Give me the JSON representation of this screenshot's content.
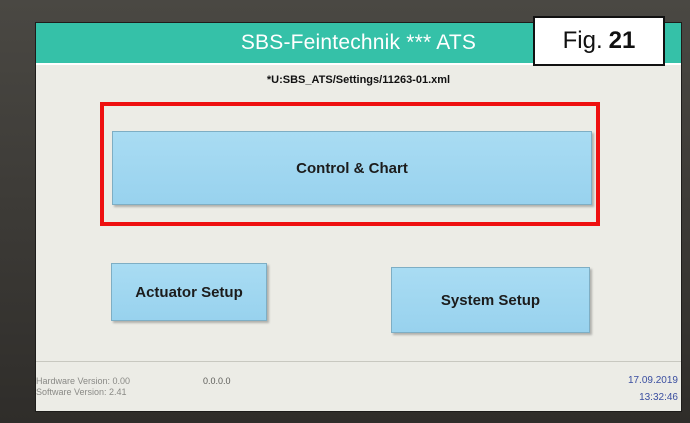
{
  "title": "SBS-Feintechnik  ***  ATS",
  "settings_path": "*U:SBS_ATS/Settings/11263-01.xml",
  "buttons": {
    "control_chart": "Control & Chart",
    "actuator_setup": "Actuator Setup",
    "system_setup": "System Setup"
  },
  "footer": {
    "hardware_version": "Hardware Version: 0.00",
    "software_version": "Software Version: 2.41",
    "version_code": "0.0.0.0",
    "date": "17.09.2019",
    "time": "13:32:46"
  },
  "figure_label": {
    "prefix": "Fig.",
    "number": "21"
  },
  "colors": {
    "title_bar": "#35c1a8",
    "button": "#a2d8f1",
    "highlight": "#ee1010",
    "timestamp": "#3a4ea0"
  }
}
